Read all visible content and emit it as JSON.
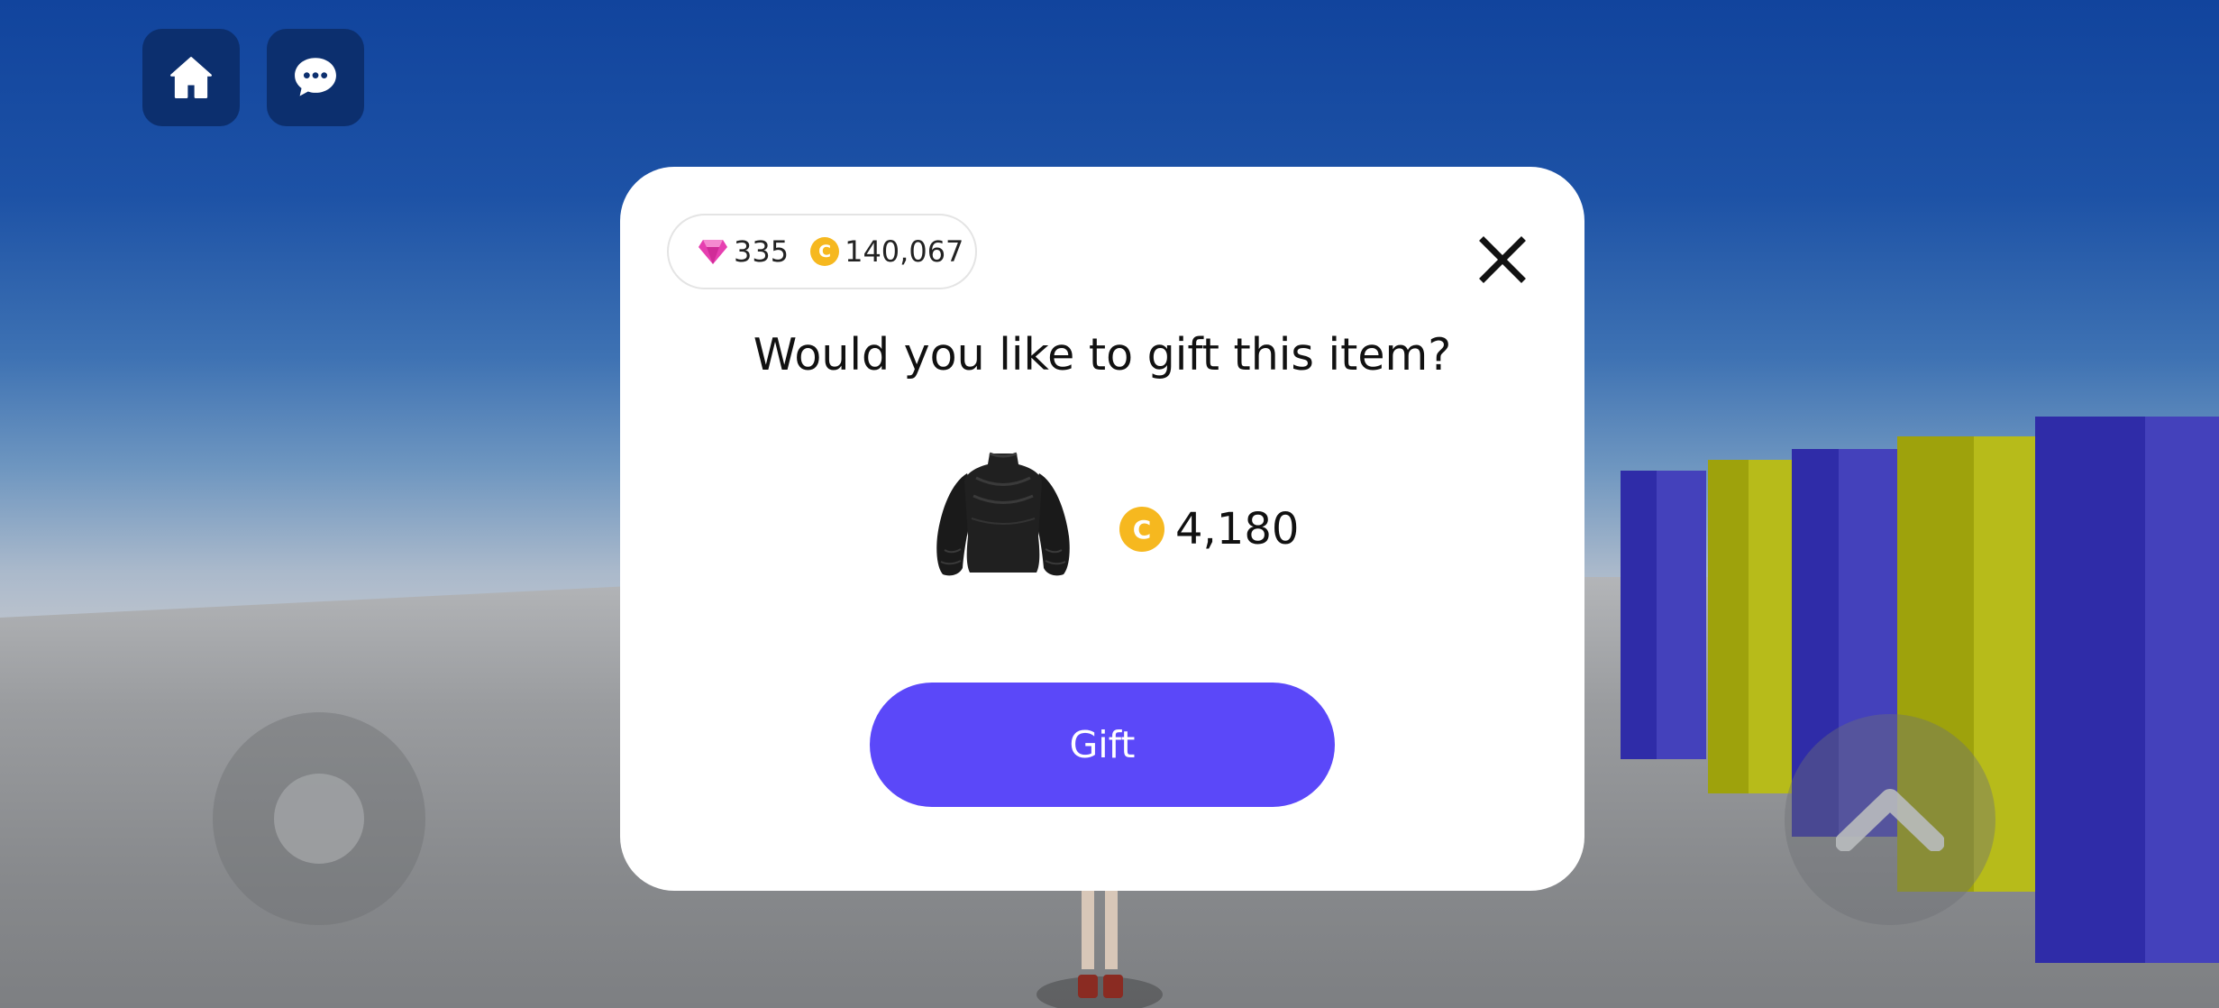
{
  "hud": {
    "home_icon": "home-icon",
    "chat_icon": "chat-bubble-icon"
  },
  "modal": {
    "gems": "335",
    "coins": "140,067",
    "coin_symbol": "C",
    "title": "Would you like to gift this item?",
    "item_icon": "black-sweater-dress",
    "price": "4,180",
    "gift_label": "Gift"
  },
  "colors": {
    "accent": "#5b48f9",
    "coin": "#f6b81f",
    "gem": "#e63fb0",
    "hud_button": "#0c2f6e"
  }
}
